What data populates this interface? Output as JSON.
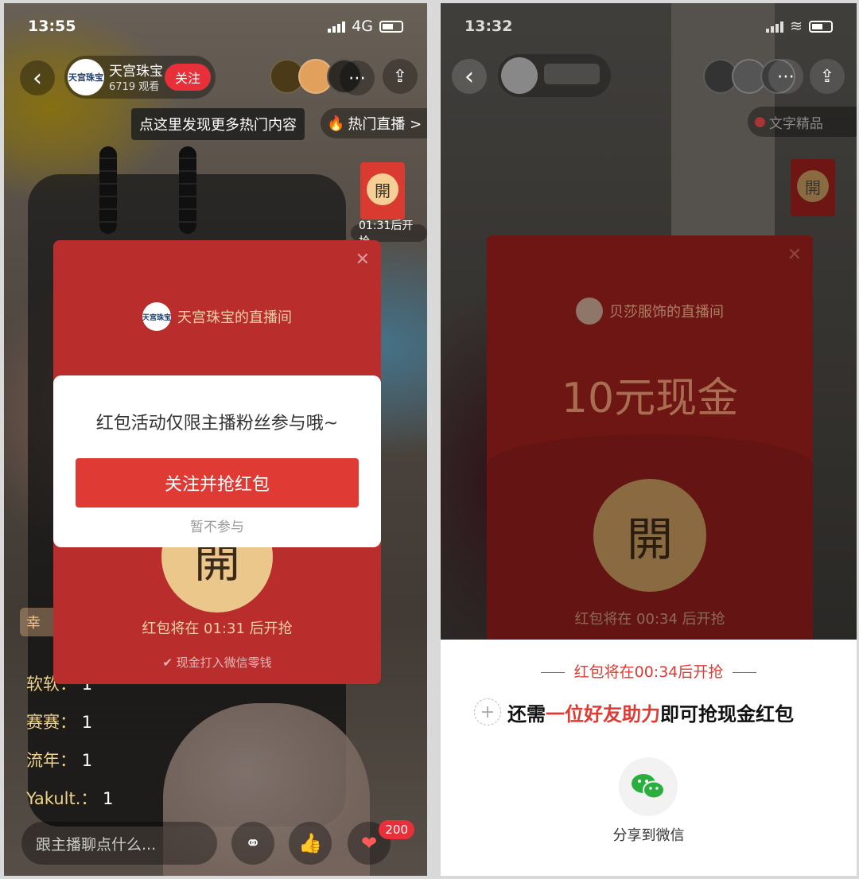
{
  "left": {
    "status": {
      "time": "13:55",
      "network": "4G"
    },
    "host": {
      "name": "天宫珠宝",
      "views": "6719 观看",
      "follow": "关注",
      "avatar_text": "天宫珠宝"
    },
    "tooltip": "点这里发现更多热门内容",
    "hot_live": "热门直播 >",
    "mini_packet": {
      "glyph": "開",
      "timer": "01:31后开抢"
    },
    "packet": {
      "host_label": "天宫珠宝的直播间",
      "open_glyph": "開",
      "timer": "红包将在 01:31 后开抢",
      "cash_note": "现金打入微信零钱"
    },
    "dialog": {
      "message": "红包活动仅限主播粉丝参与哦~",
      "primary": "关注并抢红包",
      "skip": "暂不参与"
    },
    "badge": "幸",
    "comments": [
      {
        "user": "软软：",
        "text": "1"
      },
      {
        "user": "赛赛：",
        "text": "1"
      },
      {
        "user": "流年：",
        "text": "1"
      },
      {
        "user": "Yakult.：",
        "text": "1"
      }
    ],
    "chat_placeholder": "跟主播聊点什么...",
    "like_count": "200"
  },
  "right": {
    "status": {
      "time": "13:32"
    },
    "mini_packet": {
      "glyph": "開"
    },
    "hot_tag": "文字精品",
    "packet": {
      "host_label": "贝莎服饰的直播间",
      "amount": "10元现金",
      "open_glyph": "開",
      "timer": "红包将在 00:34 后开抢"
    },
    "sheet": {
      "timer": "红包将在00:34后开抢",
      "msg_prefix": "还需",
      "msg_highlight": "一位好友助力",
      "msg_suffix": "即可抢现金红包",
      "share_label": "分享到微信"
    }
  }
}
